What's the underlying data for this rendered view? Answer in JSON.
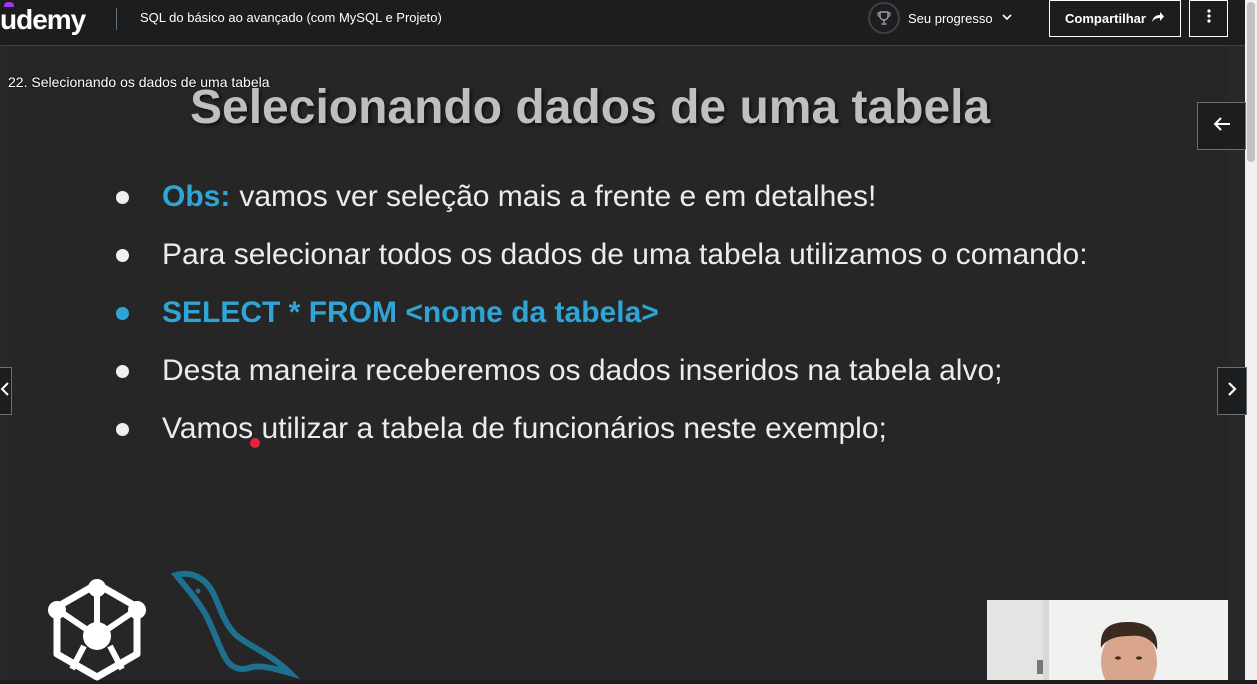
{
  "header": {
    "logo": "udemy",
    "course_title": "SQL do básico ao avançado (com MySQL e Projeto)",
    "progress_label": "Seu progresso",
    "share_label": "Compartilhar"
  },
  "lecture": {
    "label": "22. Selecionando os dados de uma tabela"
  },
  "slide": {
    "title": "Selecionando dados de uma tabela",
    "obs_label": "Obs:",
    "obs_text": "vamos ver seleção mais a frente e em detalhes!",
    "bullet2": "Para selecionar todos os dados de uma tabela utilizamos o comando:",
    "sql_command": "SELECT * FROM <nome da tabela>",
    "bullet4": "Desta maneira receberemos os dados inseridos na tabela alvo;",
    "bullet5": "Vamos utilizar a tabela de funcionários neste exemplo;"
  },
  "colors": {
    "accent_blue": "#2fa5d6",
    "udemy_purple": "#a435f0",
    "pointer_red": "#e5233d"
  },
  "icons": [
    "trophy-icon",
    "chevron-down-icon",
    "share-arrow-icon",
    "kebab-menu-icon",
    "arrow-left-icon",
    "chevron-left-icon",
    "chevron-right-icon",
    "network-cube-logo",
    "mysql-dolphin-logo"
  ]
}
